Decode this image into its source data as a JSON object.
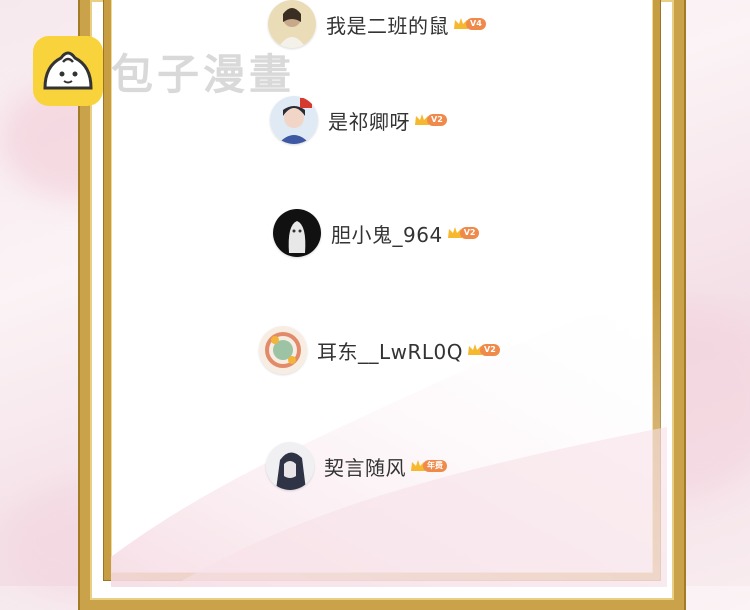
{
  "watermark": {
    "text": "包子漫畫",
    "logo_icon": "bun-logo-icon"
  },
  "colors": {
    "gold": "#c9a24a",
    "badge": "#f08a4b",
    "background": "#f6e9ee"
  },
  "users": [
    {
      "name": "我是二班的鼠",
      "badge": "V4",
      "avatar_icon": "avatar-girl-icon"
    },
    {
      "name": "是祁卿呀",
      "badge": "V2",
      "avatar_icon": "avatar-boy-icon"
    },
    {
      "name": "胆小鬼_964",
      "badge": "V2",
      "avatar_icon": "avatar-ghost-icon"
    },
    {
      "name": "耳东__LwRL0Q",
      "badge": "V2",
      "avatar_icon": "avatar-flower-icon"
    },
    {
      "name": "契言随风",
      "badge": "年费",
      "avatar_icon": "avatar-anime-icon"
    }
  ]
}
